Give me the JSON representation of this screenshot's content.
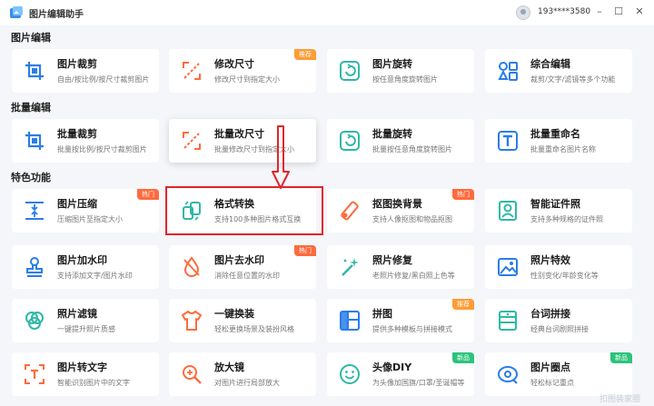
{
  "app": {
    "title": "图片编辑助手",
    "username": "193****3580",
    "buttons": {
      "minimize": "–",
      "maximize": "☐",
      "close": "✕"
    }
  },
  "sections": [
    {
      "title": "图片编辑"
    },
    {
      "title": "批量编辑"
    },
    {
      "title": "特色功能"
    }
  ],
  "cards": [
    {
      "name": "图片裁剪",
      "desc": "自由/按比例/按尺寸裁剪图片",
      "icon": "crop-icon",
      "badge": ""
    },
    {
      "name": "修改尺寸",
      "desc": "修改尺寸到指定大小",
      "icon": "resize-icon",
      "badge": "推荐"
    },
    {
      "name": "图片旋转",
      "desc": "按任意角度旋转图片",
      "icon": "rotate-icon",
      "badge": ""
    },
    {
      "name": "综合编辑",
      "desc": "裁剪/文字/滤镜等多个功能",
      "icon": "grid-icon",
      "badge": ""
    },
    {
      "name": "批量裁剪",
      "desc": "批量按比例/按尺寸裁剪图片",
      "icon": "crop-icon",
      "badge": ""
    },
    {
      "name": "批量改尺寸",
      "desc": "批量修改尺寸到指定大小",
      "icon": "resize-icon",
      "badge": ""
    },
    {
      "name": "批量旋转",
      "desc": "批量按任意角度旋转图片",
      "icon": "rotate-icon",
      "badge": ""
    },
    {
      "name": "批量重命名",
      "desc": "批量重命名图片名称",
      "icon": "rename-icon",
      "badge": ""
    },
    {
      "name": "图片压缩",
      "desc": "压缩图片至指定大小",
      "icon": "compress-icon",
      "badge": "热门"
    },
    {
      "name": "格式转换",
      "desc": "支持100多种图片格式互换",
      "icon": "convert-icon",
      "badge": ""
    },
    {
      "name": "抠图换背景",
      "desc": "支持人像抠图和物品抠图",
      "icon": "eraser-icon",
      "badge": "热门"
    },
    {
      "name": "智能证件照",
      "desc": "支持多种规格的证件照",
      "icon": "id-photo-icon",
      "badge": ""
    },
    {
      "name": "图片加水印",
      "desc": "支持添加文字/图片水印",
      "icon": "stamp-icon",
      "badge": ""
    },
    {
      "name": "图片去水印",
      "desc": "消除任意位置的水印",
      "icon": "drop-icon",
      "badge": "热门"
    },
    {
      "name": "照片修复",
      "desc": "老照片修复/黑白照上色等",
      "icon": "magic-wand-icon",
      "badge": ""
    },
    {
      "name": "照片特效",
      "desc": "性别变化/年龄变化等",
      "icon": "image-icon",
      "badge": ""
    },
    {
      "name": "照片滤镜",
      "desc": "一键提升照片质感",
      "icon": "filter-icon",
      "badge": ""
    },
    {
      "name": "一键换装",
      "desc": "轻松更换场景及装扮风格",
      "icon": "shirt-icon",
      "badge": ""
    },
    {
      "name": "拼图",
      "desc": "提供多种模板与拼接模式",
      "icon": "collage-icon",
      "badge": "推荐"
    },
    {
      "name": "台词拼接",
      "desc": "经典台词剧照拼接",
      "icon": "subtitle-icon",
      "badge": ""
    },
    {
      "name": "图片转文字",
      "desc": "智能识别图片中的文字",
      "icon": "ocr-icon",
      "badge": ""
    },
    {
      "name": "放大镜",
      "desc": "对图片进行局部放大",
      "icon": "magnifier-icon",
      "badge": ""
    },
    {
      "name": "头像DIY",
      "desc": "为头像加国旗/口罩/圣诞帽等",
      "icon": "smile-icon",
      "badge": "新品"
    },
    {
      "name": "图片圈点",
      "desc": "轻松标记重点",
      "icon": "mark-icon",
      "badge": "新品"
    }
  ],
  "watermark": "扣图装家圈",
  "colors": {
    "accent": "#2b7de9",
    "hot": "#ff6b3d",
    "recommend": "#ff9c34",
    "new": "#2cc37b",
    "annotation": "#e0252b"
  }
}
